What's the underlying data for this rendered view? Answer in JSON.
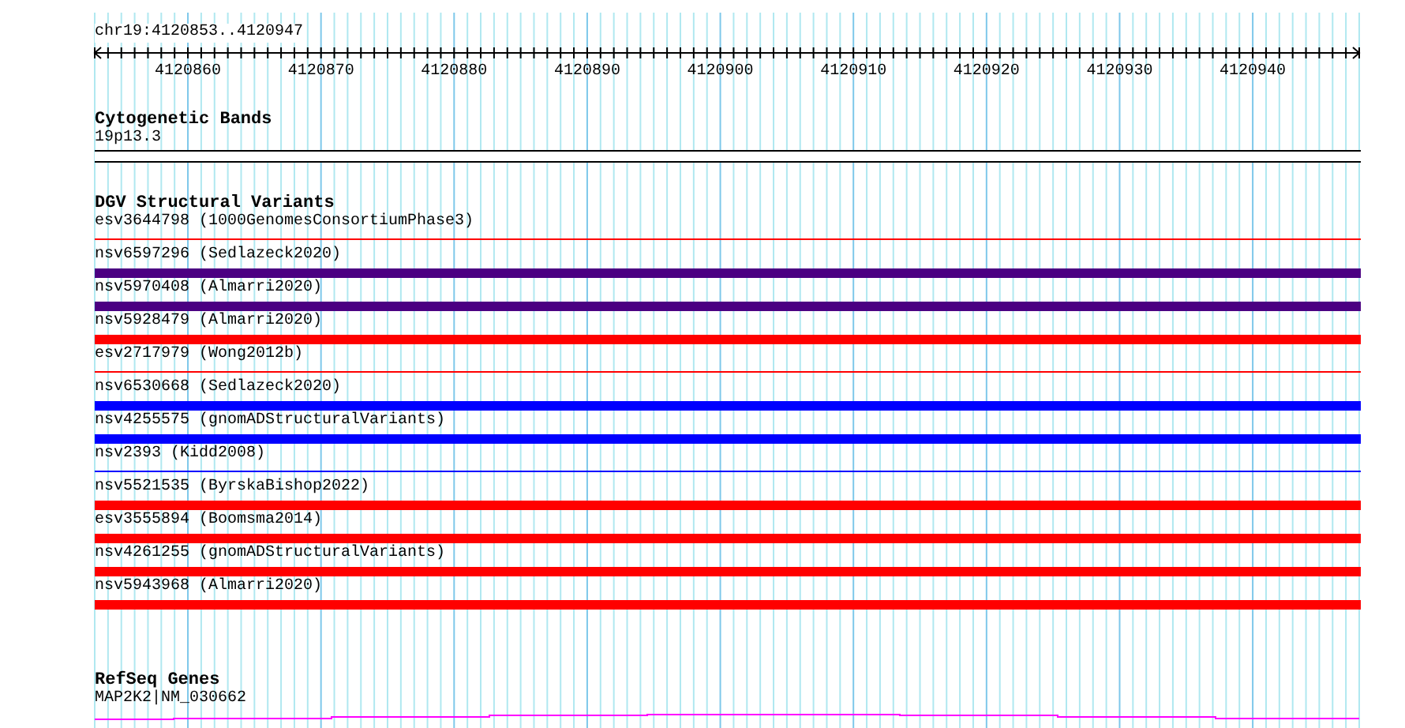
{
  "ruler": {
    "location": "chr19:4120853..4120947",
    "ticks": [
      "4120860",
      "4120870",
      "4120880",
      "4120890",
      "4120900",
      "4120910",
      "4120920",
      "4120930",
      "4120940"
    ]
  },
  "cytobands": {
    "title": "Cytogenetic Bands",
    "label": "19p13.3"
  },
  "variants": {
    "title": "DGV Structural Variants",
    "features": [
      {
        "label": "esv3644798 (1000GenomesConsortiumPhase3)",
        "kind": "line",
        "color": "#ff0000"
      },
      {
        "label": "nsv6597296 (Sedlazeck2020)",
        "kind": "bar",
        "color": "#4b0082"
      },
      {
        "label": "nsv5970408 (Almarri2020)",
        "kind": "bar",
        "color": "#4b0082"
      },
      {
        "label": "nsv5928479 (Almarri2020)",
        "kind": "bar",
        "color": "#ff0000"
      },
      {
        "label": "esv2717979 (Wong2012b)",
        "kind": "line",
        "color": "#ff0000"
      },
      {
        "label": "nsv6530668 (Sedlazeck2020)",
        "kind": "bar",
        "color": "#0000ff"
      },
      {
        "label": "nsv4255575 (gnomADStructuralVariants)",
        "kind": "bar",
        "color": "#0000ff"
      },
      {
        "label": "nsv2393 (Kidd2008)",
        "kind": "line",
        "color": "#0000ff"
      },
      {
        "label": "nsv5521535 (ByrskaBishop2022)",
        "kind": "bar",
        "color": "#ff0000"
      },
      {
        "label": "esv3555894 (Boomsma2014)",
        "kind": "bar",
        "color": "#ff0000"
      },
      {
        "label": "nsv4261255 (gnomADStructuralVariants)",
        "kind": "bar",
        "color": "#ff0000"
      },
      {
        "label": "nsv5943968 (Almarri2020)",
        "kind": "bar",
        "color": "#ff0000"
      }
    ]
  },
  "genes": {
    "title": "RefSeq Genes",
    "label": "MAP2K2|NM_030662"
  }
}
